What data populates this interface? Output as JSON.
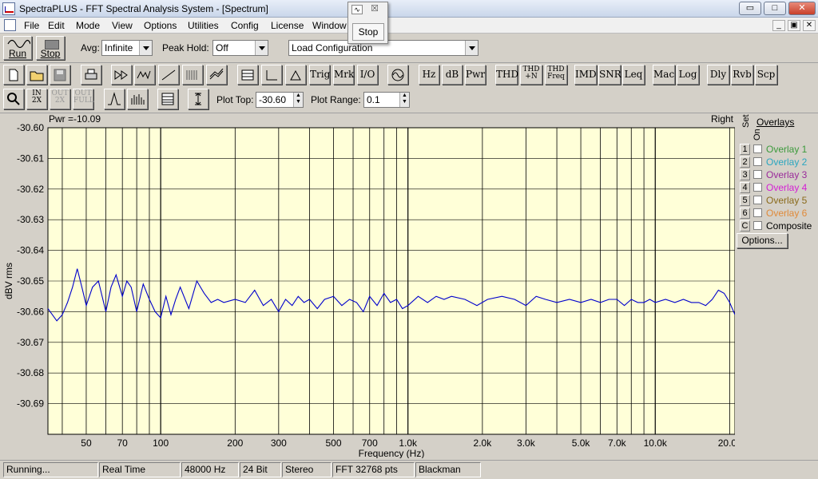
{
  "window": {
    "title": "SpectraPLUS - FFT Spectral Analysis System - [Spectrum]",
    "min_glyph": "▭",
    "max_glyph": "□",
    "close_glyph": "✕"
  },
  "menu": {
    "items": [
      "File",
      "Edit",
      "Mode",
      "View",
      "Options",
      "Utilities",
      "Config",
      "License",
      "Window"
    ],
    "mdi": [
      "_",
      "▣",
      "✕"
    ]
  },
  "stop_popup": {
    "label": "Stop",
    "close_glyph": "☒",
    "mini_glyph": "∿"
  },
  "toolbar1": {
    "run_label": "Run",
    "stop_label": "Stop",
    "avg_label": "Avg:",
    "avg_value": "Infinite",
    "peak_label": "Peak Hold:",
    "peak_value": "Off",
    "config_value": "Load Configuration"
  },
  "toolbar2": {
    "buttons": [
      "Trig",
      "Mrk",
      "I/O",
      "Hz",
      "dB",
      "Pwr",
      "THD",
      "THD\n+N",
      "THD\nFreq",
      "IMD",
      "SNR",
      "Leq",
      "Mac",
      "Log",
      "Dly",
      "Rvb",
      "Scp"
    ]
  },
  "toolbar3": {
    "plot_top_label": "Plot Top:",
    "plot_top_value": "-30.60",
    "plot_range_label": "Plot Range:",
    "plot_range_value": "0.1",
    "zoom_in_label": "IN\n2X",
    "zoom_out_label": "OUT\n2X",
    "zoom_full_label": "OUT\nFULL"
  },
  "plot": {
    "pwr_text": "Pwr =-10.09",
    "channel": "Right",
    "set_label": "Set",
    "on_label": "On",
    "overlays_title": "Overlays",
    "options_label": "Options...",
    "overlays": [
      {
        "set": "1",
        "name": "Overlay 1",
        "color": "#3c9a3c"
      },
      {
        "set": "2",
        "name": "Overlay 2",
        "color": "#2aa6c0"
      },
      {
        "set": "3",
        "name": "Overlay 3",
        "color": "#9a2a9a"
      },
      {
        "set": "4",
        "name": "Overlay 4",
        "color": "#d420d4"
      },
      {
        "set": "5",
        "name": "Overlay 5",
        "color": "#8a6a1a"
      },
      {
        "set": "6",
        "name": "Overlay 6",
        "color": "#e08a3a"
      },
      {
        "set": "C",
        "name": "Composite",
        "color": "#000000"
      }
    ]
  },
  "chart_data": {
    "type": "line",
    "title": "",
    "xlabel": "Frequency (Hz)",
    "ylabel": "dBV rms",
    "x_scale": "log",
    "xlim": [
      35,
      21000
    ],
    "ylim": [
      -30.7,
      -30.6
    ],
    "x_ticks": [
      50,
      70,
      100,
      200,
      300,
      500,
      700,
      1000,
      2000,
      3000,
      5000,
      7000,
      10000,
      20000
    ],
    "x_tick_labels": [
      "50",
      "70",
      "100",
      "200",
      "300",
      "500",
      "700",
      "1.0k",
      "2.0k",
      "3.0k",
      "5.0k",
      "7.0k",
      "10.0k",
      "20.0k"
    ],
    "y_ticks": [
      -30.6,
      -30.61,
      -30.62,
      -30.63,
      -30.64,
      -30.65,
      -30.66,
      -30.67,
      -30.68,
      -30.69
    ],
    "y_tick_labels": [
      "-30.60",
      "-30.61",
      "-30.62",
      "-30.63",
      "-30.64",
      "-30.65",
      "-30.66",
      "-30.67",
      "-30.68",
      "-30.69"
    ],
    "grid": true,
    "background": "#ffffd8",
    "line_color": "#0000cc",
    "series": [
      {
        "x": [
          35,
          38,
          40,
          42,
          44,
          46,
          48,
          50,
          53,
          56,
          60,
          63,
          66,
          70,
          73,
          76,
          80,
          85,
          90,
          95,
          100,
          105,
          110,
          115,
          120,
          130,
          140,
          150,
          160,
          170,
          180,
          200,
          220,
          240,
          260,
          280,
          300,
          320,
          340,
          360,
          380,
          400,
          430,
          460,
          500,
          540,
          580,
          620,
          660,
          700,
          750,
          800,
          850,
          900,
          950,
          1000,
          1100,
          1200,
          1300,
          1400,
          1500,
          1700,
          1900,
          2100,
          2400,
          2700,
          3000,
          3300,
          3600,
          4000,
          4500,
          5000,
          5500,
          6000,
          6500,
          7000,
          7500,
          8000,
          8500,
          9000,
          9500,
          10000,
          11000,
          12000,
          13000,
          14000,
          15000,
          16000,
          17000,
          18000,
          19000,
          20000,
          21000
        ],
        "y": [
          -30.659,
          -30.663,
          -30.661,
          -30.657,
          -30.652,
          -30.646,
          -30.652,
          -30.658,
          -30.652,
          -30.65,
          -30.66,
          -30.652,
          -30.648,
          -30.655,
          -30.65,
          -30.652,
          -30.66,
          -30.651,
          -30.656,
          -30.66,
          -30.662,
          -30.655,
          -30.661,
          -30.656,
          -30.652,
          -30.659,
          -30.65,
          -30.654,
          -30.657,
          -30.656,
          -30.657,
          -30.656,
          -30.657,
          -30.653,
          -30.658,
          -30.656,
          -30.66,
          -30.656,
          -30.658,
          -30.655,
          -30.657,
          -30.656,
          -30.659,
          -30.656,
          -30.655,
          -30.658,
          -30.656,
          -30.657,
          -30.66,
          -30.655,
          -30.658,
          -30.654,
          -30.657,
          -30.656,
          -30.659,
          -30.658,
          -30.655,
          -30.657,
          -30.655,
          -30.656,
          -30.655,
          -30.656,
          -30.658,
          -30.656,
          -30.655,
          -30.656,
          -30.658,
          -30.655,
          -30.656,
          -30.657,
          -30.656,
          -30.657,
          -30.656,
          -30.657,
          -30.656,
          -30.656,
          -30.658,
          -30.656,
          -30.657,
          -30.657,
          -30.656,
          -30.657,
          -30.656,
          -30.657,
          -30.656,
          -30.657,
          -30.657,
          -30.658,
          -30.656,
          -30.653,
          -30.654,
          -30.657,
          -30.661
        ]
      }
    ]
  },
  "status": {
    "state": "Running...",
    "mode": "Real Time",
    "rate": "48000 Hz",
    "bits": "24 Bit",
    "channels": "Stereo",
    "fft": "FFT 32768 pts",
    "window": "Blackman"
  }
}
